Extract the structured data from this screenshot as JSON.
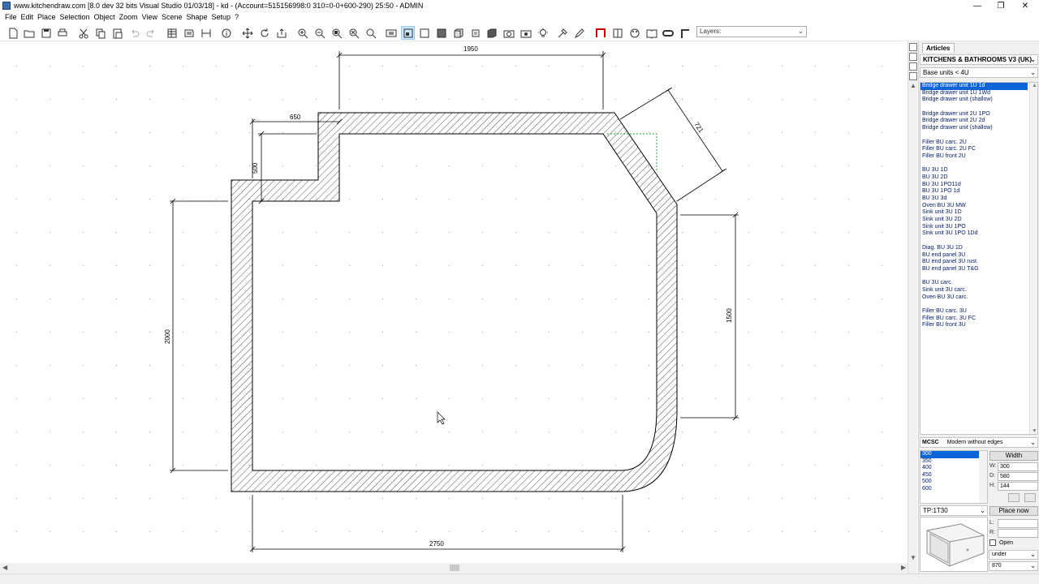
{
  "window": {
    "title": "www.kitchendraw.com [8.0 dev 32 bits Visual Studio 01/03/18] - kd - (Account=515156998:0 310=0-0+600-290) 25:50 - ADMIN",
    "minimize": "—",
    "maximize": "❐",
    "close": "✕"
  },
  "menu": [
    "File",
    "Edit",
    "Place",
    "Selection",
    "Object",
    "Zoom",
    "View",
    "Scene",
    "Shape",
    "Setup",
    "?"
  ],
  "toolbar": {
    "layers_placeholder": "Layers:",
    "caret": "⌄"
  },
  "drawing": {
    "dim_top": "1950",
    "dim_left_short": "650",
    "dim_notch_height": "500",
    "dim_diagonal": "721",
    "dim_left": "2000",
    "dim_right": "1500",
    "dim_bottom": "2750"
  },
  "panel": {
    "tab_label": "Articles",
    "catalog": "KITCHENS & BATHROOMS V3 (UK)",
    "category": "Base units < 4U",
    "caret": "⌄",
    "scroll_up": "▲",
    "scroll_down": "▼",
    "articles": [
      "Bridge drawer unit 1U 1d",
      "Bridge drawer unit 1U 1Wd",
      "Bridge drawer unit (shallow)",
      "",
      "Bridge drawer unit 2U 1PO",
      "Bridge drawer unit 2U 2d",
      "Bridge drawer unit (shallow)",
      "",
      "Filler BU carc. 2U",
      "Filler BU carc. 2U FC",
      "Filler BU front 2U",
      "",
      "BU 3U 1D",
      "BU 3U 2D",
      "BU 3U 1PO11d",
      "BU 3U 1PO 1d",
      "BU 3U 3d",
      "Oven BU 3U MW",
      "Sink unit 3U 1D",
      "Sink unit 3U 2D",
      "Sink unit 3U 1PO",
      "Sink unit 3U 1PO 1Dd",
      "",
      "Diag. BU 3U 1D",
      "BU end panel 3U",
      "BU end panel 3U rust.",
      "BU end panel 3U T&G",
      "",
      "BU 3U carc.",
      "Sink unit 3U carc.",
      "Oven BU 3U carc.",
      "",
      "Filler BU carc. 3U",
      "Filler BU carc. 3U FC",
      "Filler BU front 3U"
    ],
    "brand_code": "MCSC",
    "brand_name": "Modern without edges",
    "widths": [
      "300",
      "350",
      "400",
      "450",
      "500",
      "600"
    ],
    "width_button": "Width",
    "dims": {
      "w_label": "W:",
      "w_value": "300",
      "d_label": "D:",
      "d_value": "580",
      "h_label": "H:",
      "h_value": "144"
    },
    "handle_code": "TP:1T30",
    "place_now": "Place now",
    "l_label": "L:",
    "r_label": "R:",
    "open_label": "Open",
    "position": "under",
    "height_value": "870"
  }
}
